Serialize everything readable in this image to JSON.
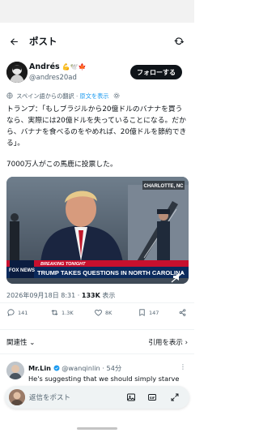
{
  "header": {
    "title": "ポスト"
  },
  "author": {
    "name": "Andrés",
    "emojis": "💪🕊️🍁",
    "handle": "@andres20ad",
    "follow_label": "フォローする"
  },
  "translation": {
    "note": "スペイン語からの翻訳",
    "show_original": "原文を表示"
  },
  "tweet": {
    "paragraph1": "トランプ：「もしブラジルから20億ドルのバナナを買うなら、実際には20億ドルを失っていることになる。だから、バナナを食べるのをやめれば、20億ドルを節約できる」。",
    "paragraph2": "7000万人がこの馬鹿に投票した。"
  },
  "media": {
    "location_tag": "CHARLOTTE, NC",
    "network": "FOX NEWS",
    "breaking_label": "BREAKING TONIGHT",
    "headline": "TRUMP TAKES QUESTIONS IN NORTH CAROLINA"
  },
  "meta": {
    "datetime": "2026年09月18日 8:31",
    "views_count": "133K",
    "views_label": "表示"
  },
  "actions": {
    "replies": "141",
    "reposts": "1.3K",
    "likes": "8K",
    "bookmarks": "147"
  },
  "sort": {
    "relevance": "関連性",
    "quotes": "引用を表示"
  },
  "reply": {
    "name": "Mr.Lin",
    "handle": "@wanqinlin",
    "time": "54分",
    "text": "He's suggesting that we should simply starve"
  },
  "compose": {
    "placeholder": "返信をポスト"
  },
  "colors": {
    "accent": "#1d9bf0",
    "text": "#0f1419",
    "muted": "#536471"
  }
}
